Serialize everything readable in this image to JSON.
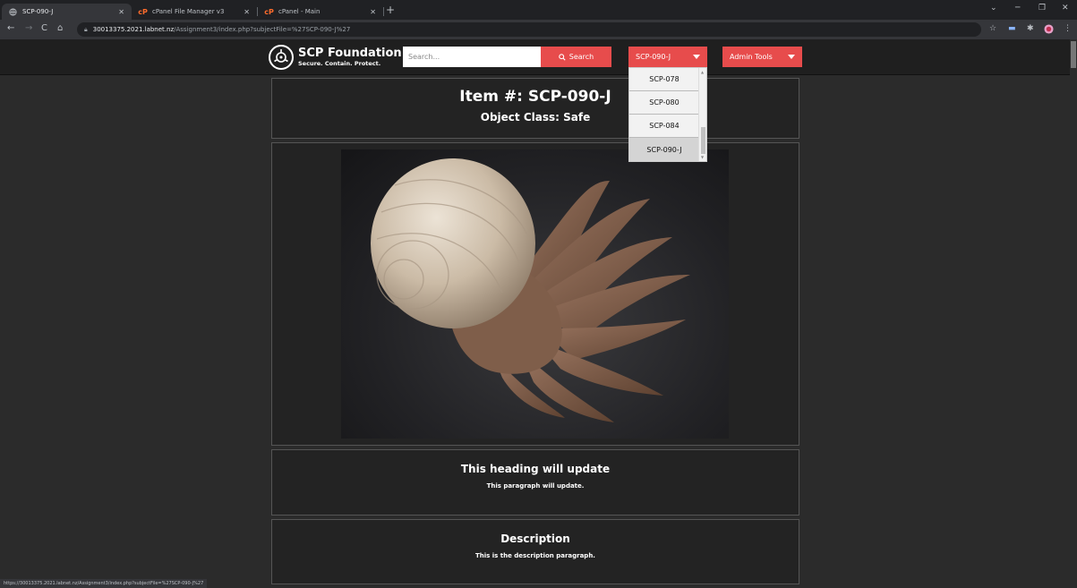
{
  "browser": {
    "tabs": [
      {
        "title": "SCP-090-J",
        "active": true
      },
      {
        "title": "cPanel File Manager v3",
        "active": false
      },
      {
        "title": "cPanel - Main",
        "active": false
      }
    ],
    "url_host": "30013375.2021.labnet.nz",
    "url_path": "/Assignment3/index.php?subjectFile=%27SCP-090-J%27",
    "status_url": "https://30013375.2021.labnet.nz/Assignment3/index.php?subjectFile=%27SCP-090-J%27"
  },
  "nav": {
    "logo_title": "SCP Foundation",
    "logo_subtitle": "Secure. Contain. Protect.",
    "search_placeholder": "Search...",
    "search_label": "Search",
    "subject_selected": "SCP-090-J",
    "subject_options": [
      "SCP-078",
      "SCP-080",
      "SCP-084",
      "SCP-090-J"
    ],
    "admin_label": "Admin Tools"
  },
  "item": {
    "title": "Item #: SCP-090-J",
    "object_class": "Object Class: Safe"
  },
  "sections": [
    {
      "heading": "This heading will update",
      "paragraph": "This paragraph will update."
    },
    {
      "heading": "Description",
      "paragraph": "This is the description paragraph."
    }
  ],
  "colors": {
    "accent": "#e74c4c",
    "page_bg": "#2b2b2b",
    "panel_bg": "#232323"
  }
}
